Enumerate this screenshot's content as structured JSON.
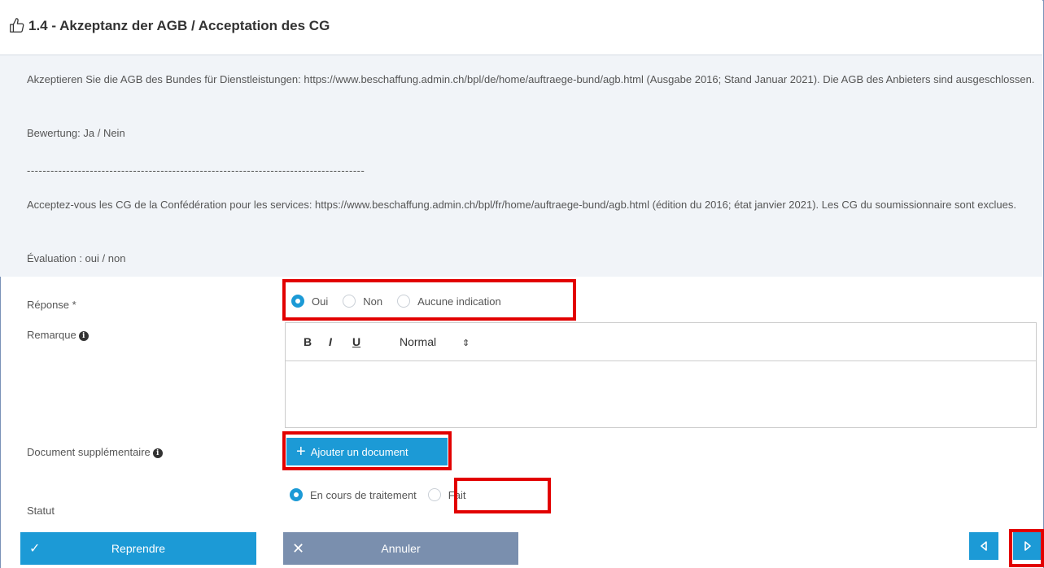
{
  "header": {
    "title": "1.4 - Akzeptanz der AGB / Acceptation des CG",
    "icon": "thumbs-up-icon"
  },
  "description": {
    "de_text": "Akzeptieren Sie die AGB des Bundes für Dienstleistungen: https://www.beschaffung.admin.ch/bpl/de/home/auftraege-bund/agb.html (Ausgabe 2016; Stand Januar 2021). Die AGB des Anbieters sind ausgeschlossen.",
    "de_rating": "Bewertung: Ja / Nein",
    "separator": "--------------------------------------------------------------------------------------",
    "fr_text": "Acceptez-vous les CG de la Confédération pour les services: https://www.beschaffung.admin.ch/bpl/fr/home/auftraege-bund/agb.html (édition du 2016; état janvier 2021). Les CG du soumissionnaire sont exclues.",
    "fr_rating": "Évaluation : oui / non"
  },
  "form": {
    "response_label": "Réponse *",
    "response_options": [
      "Oui",
      "Non",
      "Aucune indication"
    ],
    "response_selected": "Oui",
    "remark_label": "Remarque",
    "editor": {
      "bold": "B",
      "italic": "I",
      "underline": "U",
      "format": "Normal"
    },
    "document_label": "Document supplémentaire",
    "add_document": "Ajouter un document",
    "status_label": "Statut",
    "status_options": [
      "En cours de traitement",
      "Fait"
    ],
    "status_selected": "En cours de traitement"
  },
  "footer": {
    "resume": "Reprendre",
    "cancel": "Annuler"
  },
  "colors": {
    "accent": "#1c9ad6",
    "cancel": "#7a8fae",
    "highlight": "#e20000",
    "description_bg": "#f1f4f8"
  }
}
